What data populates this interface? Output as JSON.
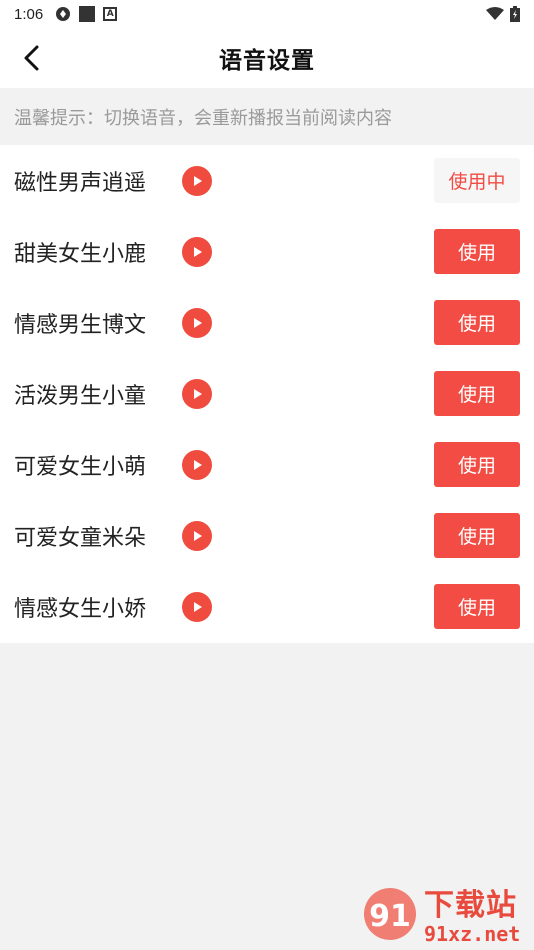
{
  "status_bar": {
    "time": "1:06"
  },
  "header": {
    "title": "语音设置"
  },
  "tip": {
    "text": "温馨提示：切换语音，会重新播报当前阅读内容"
  },
  "voices": [
    {
      "name": "磁性男声逍遥",
      "button": "使用中"
    },
    {
      "name": "甜美女生小鹿",
      "button": "使用"
    },
    {
      "name": "情感男生博文",
      "button": "使用"
    },
    {
      "name": "活泼男生小童",
      "button": "使用"
    },
    {
      "name": "可爱女生小萌",
      "button": "使用"
    },
    {
      "name": "可爱女童米朵",
      "button": "使用"
    },
    {
      "name": "情感女生小娇",
      "button": "使用"
    }
  ],
  "watermark": {
    "logo_text": "91",
    "brand": "下载站",
    "url": "91xz.net"
  },
  "colors": {
    "accent": "#f24c44",
    "tip_text": "#9a9a9a",
    "background": "#f2f2f2"
  }
}
